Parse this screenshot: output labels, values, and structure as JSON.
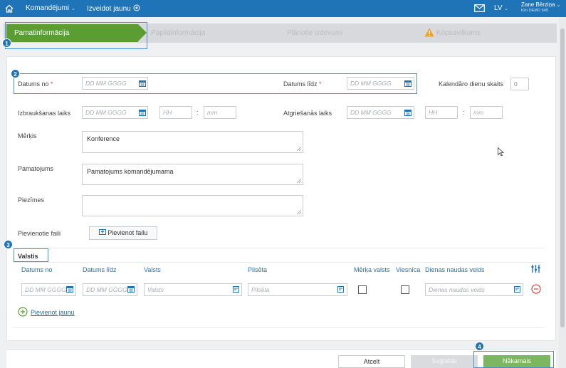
{
  "topbar": {
    "menu_commissions": "Komandējumi",
    "menu_create": "Izveidot jaunu",
    "lang": "LV",
    "user_name": "Zane Bērziņa",
    "user_org": "h2o DEMO 545"
  },
  "wizard": {
    "steps": [
      "Pamatinformācija",
      "Papildinformācija",
      "Plānotie izdevumi",
      "Kopsavilkums"
    ],
    "active_step": 0
  },
  "markers": [
    "1",
    "2",
    "3",
    "4"
  ],
  "form": {
    "date_from_label": "Datums no",
    "date_to_label": "Datums līdz",
    "required_mark": "*",
    "date_placeholder": "DD MM GGGG",
    "calendar_days_label": "Kalendāro dienu skaits",
    "calendar_days_value": "0",
    "departure_label": "Izbraukšanas laiks",
    "return_label": "Atgriešanās laiks",
    "hour_placeholder": "HH",
    "minute_placeholder": "mm",
    "time_separator": ":",
    "purpose_label": "Mērķis",
    "purpose_value": "Konference",
    "justification_label": "Pamatojums",
    "justification_value": "Pamatojums komandējumama",
    "notes_label": "Piezīmes",
    "notes_value": "",
    "files_label": "Pievienotie faili",
    "add_file_button": "Pievienot failu"
  },
  "countries": {
    "section_title": "Valstis",
    "columns": [
      "Datums no",
      "Datums līdz",
      "Valsts",
      "Pilsēta",
      "Mērķa valsts",
      "Viesnīca",
      "Dienas naudas veids"
    ],
    "row": {
      "date_from": "DD MM GGGG",
      "date_to": "DD MM GGGG",
      "country": "Valsts",
      "city": "Pilsēta",
      "allowance_type": "Dienas naudas veids"
    },
    "add_new_link": "Pievienot jaunu"
  },
  "footer": {
    "cancel": "Atcelt",
    "save": "Saglabāt",
    "next": "Nākamais"
  },
  "colors": {
    "topbar": "#1f73b7",
    "active_step": "#5a9e33",
    "next_button": "#7bb661",
    "required": "#d9534f"
  }
}
